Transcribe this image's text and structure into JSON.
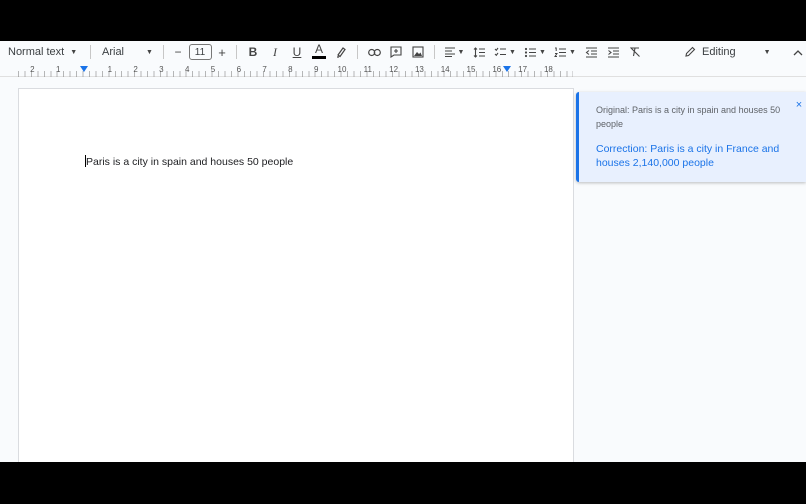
{
  "toolbar": {
    "style_value": "Normal text",
    "font_value": "Arial",
    "font_size": "11",
    "decrease_symbol": "−",
    "increase_symbol": "+",
    "bold": "B",
    "italic": "I",
    "underline": "U",
    "text_color": "A",
    "text_color_swatch": "#000000",
    "mode_label": "Editing"
  },
  "ruler": {
    "labels": [
      "2",
      "1",
      "1",
      "2",
      "3",
      "4",
      "5",
      "6",
      "7",
      "8",
      "9",
      "10",
      "11",
      "12",
      "13",
      "14",
      "15",
      "16",
      "17",
      "18"
    ]
  },
  "document": {
    "body_text": "Paris is a city in spain and houses 50 people"
  },
  "suggestion": {
    "original": "Original: Paris is a city in spain and houses 50 people",
    "correction": "Correction: Paris is a city in France and houses 2,140,000 people",
    "close_symbol": "×"
  },
  "colors": {
    "accent": "#1a73e8",
    "card_bg": "#e8f0fe",
    "chrome_bg": "#f9fbfd",
    "frame": "#000000"
  },
  "icons": [
    "chevron-down-icon",
    "link-icon",
    "add-comment-icon",
    "image-icon",
    "align-left-icon",
    "line-spacing-icon",
    "checklist-icon",
    "bulleted-list-icon",
    "numbered-list-icon",
    "decrease-indent-icon",
    "increase-indent-icon",
    "clear-formatting-icon",
    "highlighter-icon",
    "pencil-icon",
    "chevron-up-icon",
    "close-icon"
  ]
}
